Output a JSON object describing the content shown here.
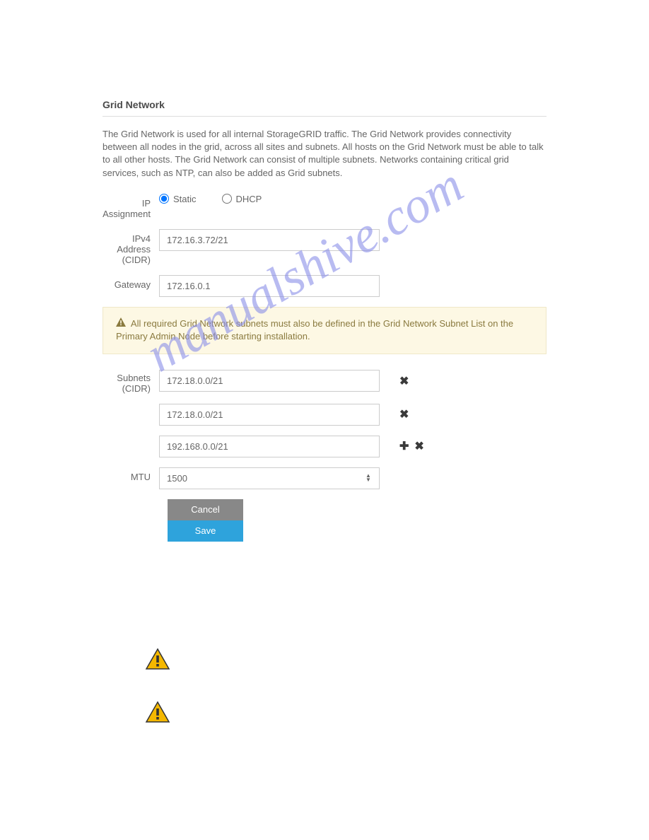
{
  "section": {
    "title": "Grid Network",
    "description": "The Grid Network is used for all internal StorageGRID traffic. The Grid Network provides connectivity between all nodes in the grid, across all sites and subnets. All hosts on the Grid Network must be able to talk to all other hosts. The Grid Network can consist of multiple subnets. Networks containing critical grid services, such as NTP, can also be added as Grid subnets."
  },
  "labels": {
    "ip_assignment": "IP Assignment",
    "ipv4_address": "IPv4 Address (CIDR)",
    "gateway": "Gateway",
    "subnets": "Subnets (CIDR)",
    "mtu": "MTU"
  },
  "ip_assignment": {
    "static_label": "Static",
    "dhcp_label": "DHCP",
    "selected": "static"
  },
  "fields": {
    "ipv4_address": "172.16.3.72/21",
    "gateway": "172.16.0.1",
    "mtu": "1500"
  },
  "alert": {
    "text": " All required Grid Network subnets must also be defined in the Grid Network Subnet List on the Primary Admin Node before starting installation."
  },
  "subnets": [
    "172.18.0.0/21",
    "172.18.0.0/21",
    "192.168.0.0/21"
  ],
  "buttons": {
    "cancel": "Cancel",
    "save": "Save"
  },
  "watermark": "manualshive.com"
}
